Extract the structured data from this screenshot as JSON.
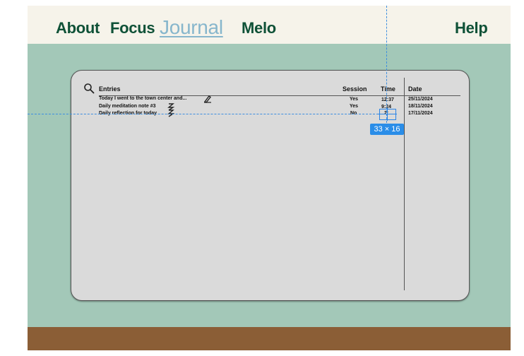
{
  "nav": {
    "items": [
      {
        "label": "About"
      },
      {
        "label": "Focus"
      },
      {
        "label": "Journal"
      },
      {
        "label": "Melo"
      }
    ],
    "help_label": "Help"
  },
  "colors": {
    "nav_bg": "#f6f3ea",
    "page_bg": "#a3c8b8",
    "nav_text": "#0f5137",
    "nav_active": "#87b6cc",
    "card_bg": "#dadada",
    "footer": "#8b5e36",
    "selection": "#2a8de8"
  },
  "journal": {
    "columns": {
      "entries": "Entries",
      "session": "Session",
      "time": "Time",
      "date": "Date"
    },
    "rows": [
      {
        "title": "Today I went to the town center and...",
        "session": "Yes",
        "time": "12:37",
        "date": "25/11/2024"
      },
      {
        "title": "Daily meditation note #3",
        "session": "Yes",
        "time": "9:24",
        "date": "18/11/2024"
      },
      {
        "title": "Daily reflection for today",
        "session": "No",
        "time": "2:",
        "date": "17/11/2024"
      }
    ]
  },
  "selection": {
    "size_label": "33 × 16"
  }
}
